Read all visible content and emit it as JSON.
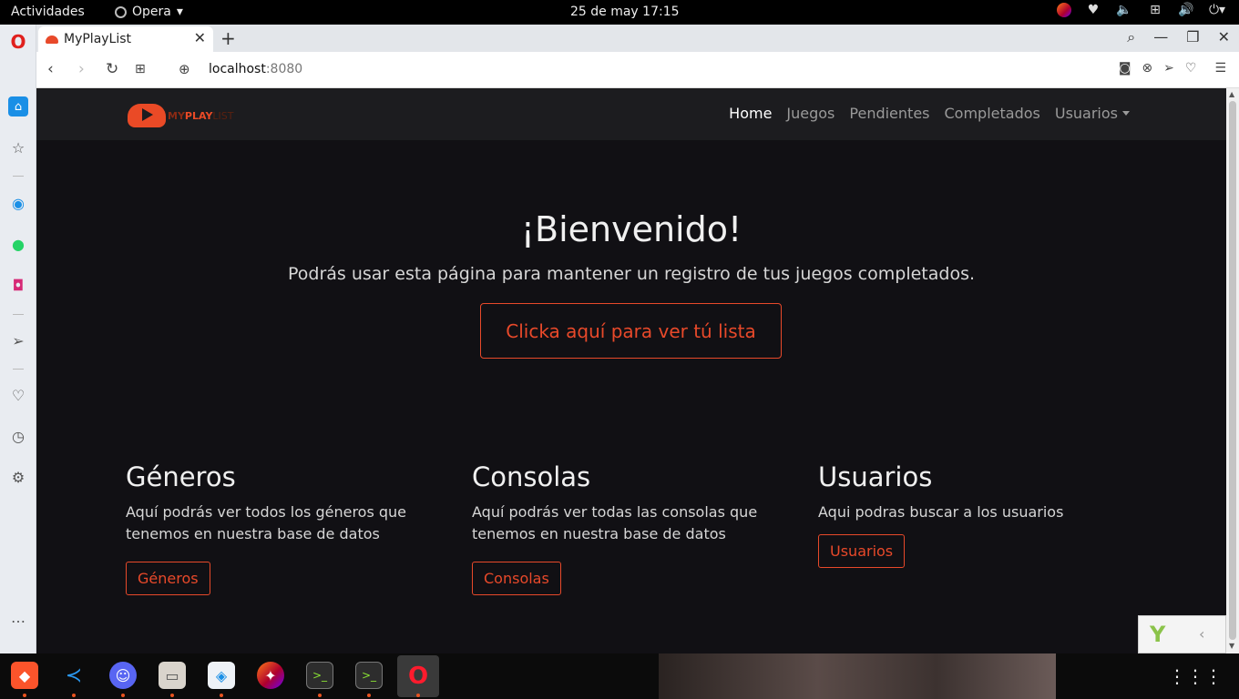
{
  "system": {
    "activities": "Actividades",
    "app_name": "Opera",
    "clock": "25 de may  17:15"
  },
  "browser": {
    "tab_title": "MyPlayList",
    "url_host": "localhost",
    "url_port": ":8080"
  },
  "site": {
    "logo": {
      "my": "MY",
      "play": "PLAY",
      "list": "LIST"
    },
    "nav": {
      "home": "Home",
      "juegos": "Juegos",
      "pendientes": "Pendientes",
      "completados": "Completados",
      "usuarios": "Usuarios"
    },
    "hero": {
      "title": "¡Bienvenido!",
      "subtitle": "Podrás usar esta página para mantener un registro de tus juegos completados.",
      "button": "Clicka aquí para ver tú lista"
    },
    "sections": [
      {
        "title": "Géneros",
        "text": "Aquí podrás ver todos los géneros que tenemos en nuestra base de datos",
        "button": "Géneros"
      },
      {
        "title": "Consolas",
        "text": "Aquí podrás ver todas las consolas que tenemos en nuestra base de datos",
        "button": "Consolas"
      },
      {
        "title": "Usuarios",
        "text": "Aqui podras buscar a los usuarios",
        "button": "Usuarios"
      }
    ]
  },
  "colors": {
    "accent": "#e8492a",
    "page_bg": "#111014",
    "navbar_bg": "#1c1c1f"
  }
}
